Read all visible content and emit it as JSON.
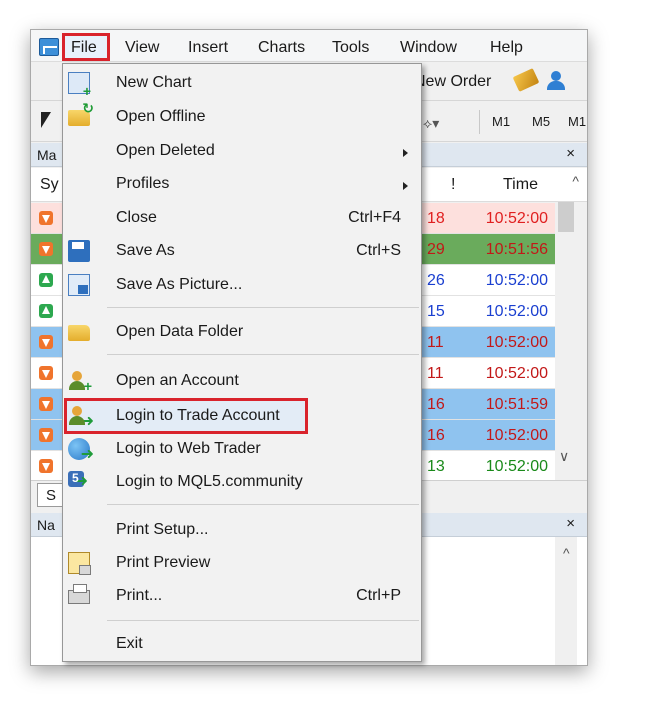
{
  "menubar": {
    "items": [
      "File",
      "View",
      "Insert",
      "Charts",
      "Tools",
      "Window",
      "Help"
    ]
  },
  "toolbar": {
    "new_order": "New Order",
    "timeframes": [
      "M1",
      "M5",
      "M1"
    ]
  },
  "market_watch": {
    "title": "Ma",
    "col_symbol": "Sy",
    "col_bang": "!",
    "col_time": "Time",
    "close": "×",
    "tab_label": "S",
    "rows": [
      {
        "dir": "down",
        "val": "18",
        "time": "10:52:00",
        "bg": "#fde0dd",
        "color": "#e02020"
      },
      {
        "dir": "down",
        "val": "29",
        "time": "10:51:56",
        "bg": "#6aab5c",
        "color": "#c21818"
      },
      {
        "dir": "up",
        "val": "26",
        "time": "10:52:00",
        "bg": "#ffffff",
        "color": "#1a3fd0"
      },
      {
        "dir": "up",
        "val": "15",
        "time": "10:52:00",
        "bg": "#ffffff",
        "color": "#1a3fd0"
      },
      {
        "dir": "down",
        "val": "11",
        "time": "10:52:00",
        "bg": "#8fc3ef",
        "color": "#c21818"
      },
      {
        "dir": "down",
        "val": "11",
        "time": "10:52:00",
        "bg": "#ffffff",
        "color": "#c21818"
      },
      {
        "dir": "down",
        "val": "16",
        "time": "10:51:59",
        "bg": "#8fc3ef",
        "color": "#c21818"
      },
      {
        "dir": "down",
        "val": "16",
        "time": "10:52:00",
        "bg": "#8fc3ef",
        "color": "#c21818"
      },
      {
        "dir": "down",
        "val": "13",
        "time": "10:52:00",
        "bg": "#ffffff",
        "color": "#1a8a1a"
      }
    ]
  },
  "navigator": {
    "title": "Na",
    "close": "×"
  },
  "file_menu": {
    "items": [
      {
        "label": "New Chart",
        "shortcut": "",
        "submenu": false
      },
      {
        "label": "Open Offline",
        "shortcut": "",
        "submenu": false
      },
      {
        "label": "Open Deleted",
        "shortcut": "",
        "submenu": true
      },
      {
        "label": "Profiles",
        "shortcut": "",
        "submenu": true
      },
      {
        "label": "Close",
        "shortcut": "Ctrl+F4",
        "submenu": false
      },
      {
        "label": "Save As",
        "shortcut": "Ctrl+S",
        "submenu": false
      },
      {
        "label": "Save As Picture...",
        "shortcut": "",
        "submenu": false
      },
      {
        "label": "Open Data Folder",
        "shortcut": "",
        "submenu": false
      },
      {
        "label": "Open an Account",
        "shortcut": "",
        "submenu": false
      },
      {
        "label": "Login to Trade Account",
        "shortcut": "",
        "submenu": false
      },
      {
        "label": "Login to Web Trader",
        "shortcut": "",
        "submenu": false
      },
      {
        "label": "Login to MQL5.community",
        "shortcut": "",
        "submenu": false
      },
      {
        "label": "Print Setup...",
        "shortcut": "",
        "submenu": false
      },
      {
        "label": "Print Preview",
        "shortcut": "",
        "submenu": false
      },
      {
        "label": "Print...",
        "shortcut": "Ctrl+P",
        "submenu": false
      },
      {
        "label": "Exit",
        "shortcut": "",
        "submenu": false
      }
    ]
  },
  "colors": {
    "highlight_border": "#d9232c",
    "menu_bg": "#f2f2f2"
  }
}
